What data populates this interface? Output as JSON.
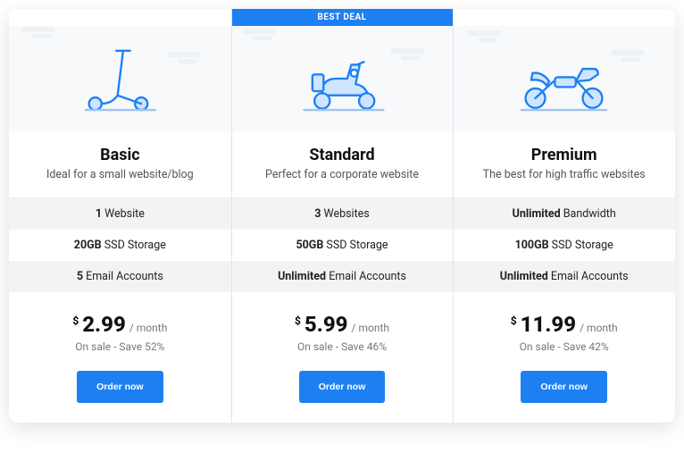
{
  "badge_label": "BEST DEAL",
  "plans": [
    {
      "title": "Basic",
      "description": "Ideal for a small website/blog",
      "features": [
        {
          "bold": "1",
          "rest": " Website"
        },
        {
          "bold": "20GB",
          "rest": " SSD Storage"
        },
        {
          "bold": "5",
          "rest": " Email Accounts"
        }
      ],
      "currency": "$",
      "price": "2.99",
      "period": "/ month",
      "sale_text": "On sale - Save 52%",
      "cta": "Order now",
      "icon": "scooter"
    },
    {
      "title": "Standard",
      "description": "Perfect for a corporate website",
      "features": [
        {
          "bold": "3",
          "rest": " Websites"
        },
        {
          "bold": "50GB",
          "rest": " SSD Storage"
        },
        {
          "bold": "Unlimited",
          "rest": " Email Accounts"
        }
      ],
      "currency": "$",
      "price": "5.99",
      "period": "/ month",
      "sale_text": "On sale - Save 46%",
      "cta": "Order now",
      "badge": true,
      "icon": "moped"
    },
    {
      "title": "Premium",
      "description": "The best for high traffic websites",
      "features": [
        {
          "bold": "Unlimited",
          "rest": " Bandwidth"
        },
        {
          "bold": "100GB",
          "rest": " SSD Storage"
        },
        {
          "bold": "Unlimited",
          "rest": " Email Accounts"
        }
      ],
      "currency": "$",
      "price": "11.99",
      "period": "/ month",
      "sale_text": "On sale - Save 42%",
      "cta": "Order now",
      "icon": "motorcycle"
    }
  ]
}
